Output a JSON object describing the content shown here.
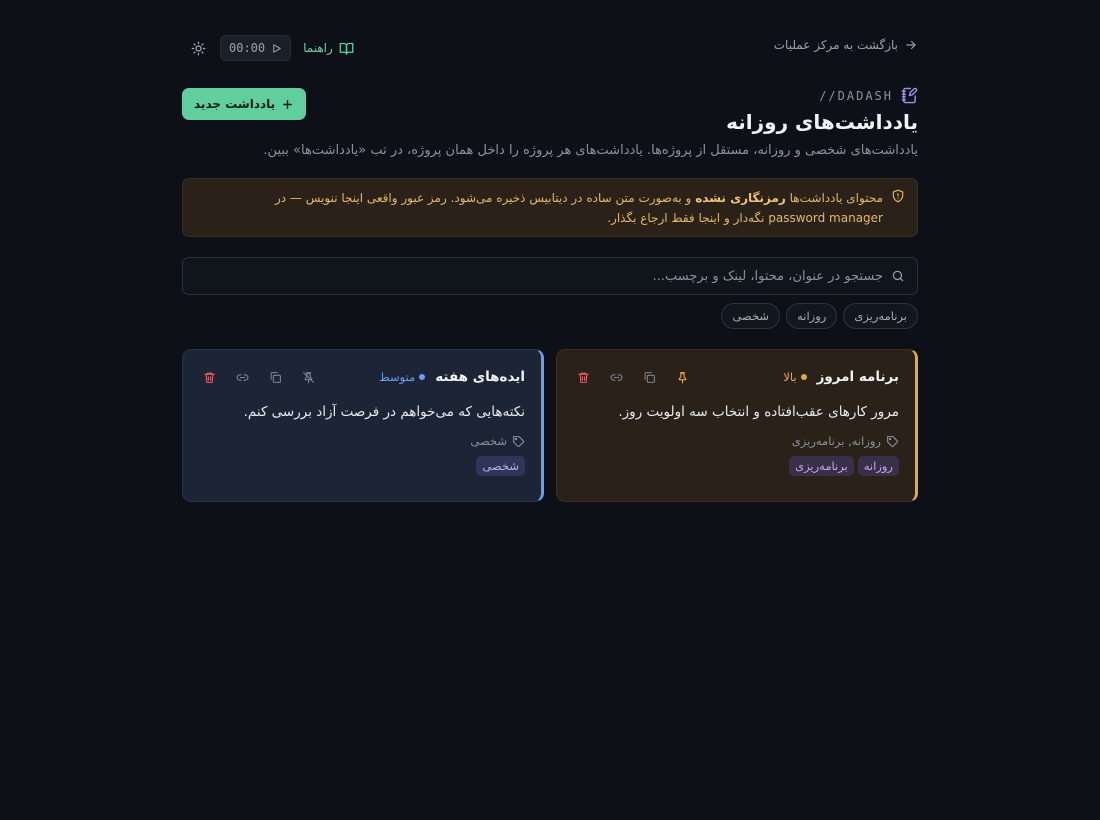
{
  "topbar": {
    "back_label": "بازگشت به مرکز عملیات",
    "guide_label": "راهنما",
    "timer": "00:00"
  },
  "header": {
    "brand": "//DADASH",
    "title": "یادداشت‌های روزانه",
    "subtitle": "یادداشت‌های شخصی و روزانه، مستقل از پروژه‌ها. یادداشت‌های هر پروژه را داخل همان پروژه، در تب «یادداشت‌ها» ببین.",
    "new_note_label": "یادداشت جدید"
  },
  "warning": {
    "prefix": "محتوای یادداشت‌ها",
    "emphasis": "رمزنگاری نشده",
    "suffix": "و به‌صورت متن ساده در دیتابیس ذخیره می‌شود. رمز عبور واقعی اینجا ننویس — در password manager نگه‌دار و اینجا فقط ارجاع بگذار."
  },
  "search": {
    "placeholder": "جستجو در عنوان، محتوا، لینک و برچسب..."
  },
  "filter_tags": [
    "برنامه‌ریزی",
    "روزانه",
    "شخصی"
  ],
  "notes": [
    {
      "title": "برنامه امروز",
      "priority": "بالا",
      "body": "مرور کارهای عقب‌افتاده و انتخاب سه اولویت روز.",
      "tags_line": "روزانه, برنامه‌ریزی",
      "tags": [
        "روزانه",
        "برنامه‌ریزی"
      ],
      "pinned": true
    },
    {
      "title": "ایده‌های هفته",
      "priority": "متوسط",
      "body": "نکته‌هایی که می‌خواهم در فرصت آزاد بررسی کنم.",
      "tags_line": "شخصی",
      "tags": [
        "شخصی"
      ],
      "pinned": false
    }
  ],
  "colors": {
    "background": "#0d1016",
    "accent": "#5fcf9e",
    "priority_high": "#e3a84a",
    "priority_mid": "#6b9ef0",
    "danger": "#e26565",
    "warning_text": "#e6b760"
  },
  "icons": {
    "back": "arrow-right-icon",
    "guide": "book-open-icon",
    "timer": "play-icon",
    "theme": "sun-icon",
    "brand": "notebook-pen-icon",
    "new": "plus-icon",
    "warning": "shield-alert-icon",
    "search": "search-icon",
    "tag": "tag-icon",
    "pin": "pin-icon",
    "unpin": "pin-off-icon",
    "copy": "copy-icon",
    "link": "link-icon",
    "delete": "trash-icon"
  }
}
